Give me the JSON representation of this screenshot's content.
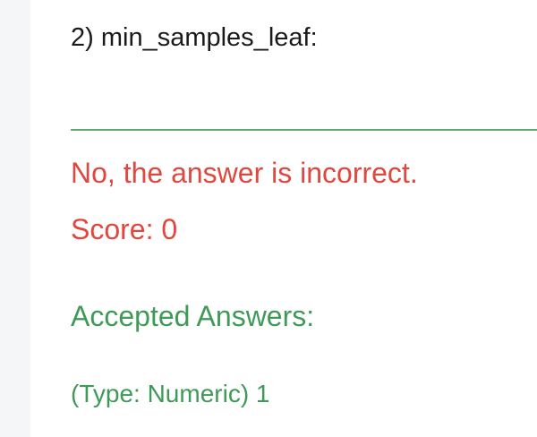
{
  "question": {
    "label": "2) min_samples_leaf:",
    "answer_value": ""
  },
  "result": {
    "feedback": "No, the answer is incorrect.",
    "score": "Score: 0"
  },
  "accepted": {
    "heading": "Accepted Answers:",
    "answer": "(Type: Numeric) 1"
  },
  "colors": {
    "incorrect": "#e0473f",
    "accepted": "#3f9a58",
    "input_underline": "#5fa86a",
    "gutter": "#f5f6f7"
  }
}
